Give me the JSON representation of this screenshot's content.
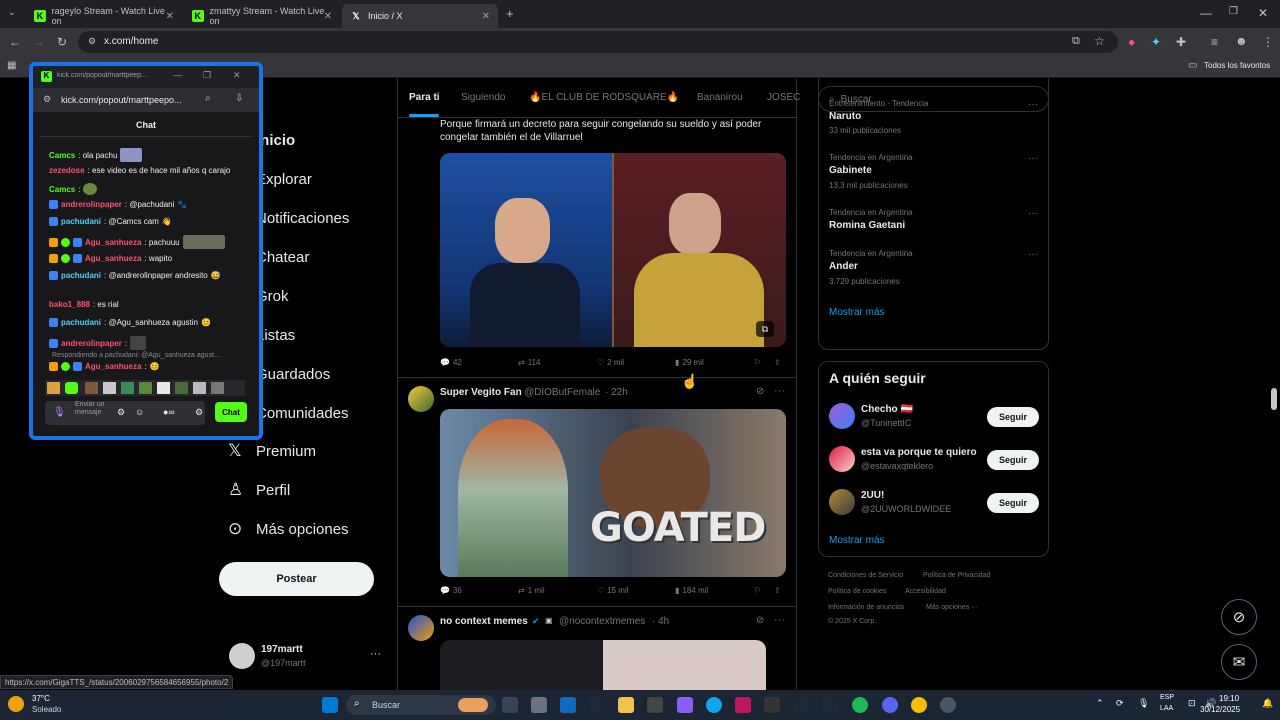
{
  "browser": {
    "tabs": [
      {
        "title": "rageylo Stream - Watch Live on",
        "favicon": "kick-icon"
      },
      {
        "title": "zmattyy Stream - Watch Live on",
        "favicon": "kick-icon"
      },
      {
        "title": "Inicio / X",
        "favicon": "x-icon"
      }
    ],
    "new_tab": "+",
    "url": "x.com/home",
    "bookmarks_label": "Todos los favoritos",
    "status_url": "https://x.com/GigaTTS_/status/2006029756584656955/photo/2"
  },
  "popup": {
    "url_title": "kick.com/popout/marttpeep...",
    "url": "kick.com/popout/marttpeepo...",
    "chat_title": "Chat",
    "messages": [
      {
        "user": "Camcs",
        "text": ": ola pachu"
      },
      {
        "user": "zezedose",
        "text": ": ese video es de hace mil años q carajo"
      },
      {
        "user": "Camcs",
        "text": ":"
      },
      {
        "user": "andrerolinpaper",
        "text": ": @pachudani"
      },
      {
        "user": "pachudani",
        "text": ": @Camcs cam"
      },
      {
        "user": "Agu_sanhueza",
        "text": ": pachuuu"
      },
      {
        "user": "Agu_sanhueza",
        "text": ": wapito"
      },
      {
        "user": "pachudani",
        "text": ": @andrerolinpaper andresito"
      },
      {
        "user": "bako1_888",
        "text": ": es rial"
      },
      {
        "user": "pachudani",
        "text": ": @Agu_sanhueza agustin"
      },
      {
        "user": "andrerolinpaper",
        "text": ":"
      },
      {
        "user": "",
        "text": "Respondiendo a pachudani: @Agu_sanhueza agust..."
      },
      {
        "user": "Agu_sanhueza",
        "text": ":"
      }
    ],
    "input_placeholder": "Enviar un mensaje",
    "chat_button": "Chat"
  },
  "nav": {
    "items": [
      "Inicio",
      "Explorar",
      "Notificaciones",
      "Chatear",
      "Grok",
      "Listas",
      "Guardados",
      "Comunidades",
      "Premium",
      "Perfil",
      "Más opciones"
    ],
    "post_button": "Postear",
    "account_name": "197martt",
    "account_handle": "@197martt"
  },
  "feed": {
    "tabs": [
      "Para ti",
      "Siguiendo",
      "🔥EL CLUB DE RODSQUARE🔥",
      "Bananirou",
      "JOSEC"
    ],
    "post1": {
      "text": "Porque firmará un decreto para seguir congelando su sueldo y así poder congelar también el de Villarruel",
      "replies": "42",
      "reposts": "114",
      "likes": "2 mil",
      "views": "29 mil"
    },
    "post2": {
      "name": "Super Vegito Fan",
      "handle": "@DIOButFemale",
      "time": "· 22h",
      "image_caption": "GOATED",
      "replies": "36",
      "reposts": "1 mil",
      "likes": "15 mil",
      "views": "184 mil"
    },
    "post3": {
      "name": "no context memes",
      "handle": "@nocontextmemes",
      "time": "· 4h"
    }
  },
  "right": {
    "search_placeholder": "Buscar",
    "trends": [
      {
        "meta": "Entretenimiento · Tendencia",
        "name": "Naruto",
        "count": "33 mil publicaciones"
      },
      {
        "meta": "Tendencia en Argentina",
        "name": "Gabinete",
        "count": "13,3 mil publicaciones"
      },
      {
        "meta": "Tendencia en Argentina",
        "name": "Romina Gaetani",
        "count": ""
      },
      {
        "meta": "Tendencia en Argentina",
        "name": "Ander",
        "count": "3.729 publicaciones"
      }
    ],
    "show_more": "Mostrar más",
    "who_to_follow": "A quién seguir",
    "follow": [
      {
        "name": "Checho 🇦🇹",
        "handle": "@TuninettIC",
        "button": "Seguir"
      },
      {
        "name": "esta va porque te quiero",
        "handle": "@estavaxqteklero",
        "button": "Seguir"
      },
      {
        "name": "2UU!",
        "handle": "@2UUWORLDWIDEE",
        "button": "Seguir"
      }
    ],
    "show_more2": "Mostrar más",
    "footer": [
      "Condiciones de Servicio",
      "Política de Privacidad",
      "Política de cookies",
      "Accesibilidad",
      "Información de anuncios",
      "Más opciones ···",
      "© 2025 X Corp."
    ]
  },
  "taskbar": {
    "weather_temp": "37°C",
    "weather_text": "Soleado",
    "search": "Buscar",
    "lang1": "ESP",
    "lang2": "LAA",
    "time": "19:10",
    "date": "30/12/2025"
  },
  "colors": {
    "x_blue": "#1d9bf0",
    "kick_green": "#53fc18",
    "popup_border": "#1a73e8"
  }
}
